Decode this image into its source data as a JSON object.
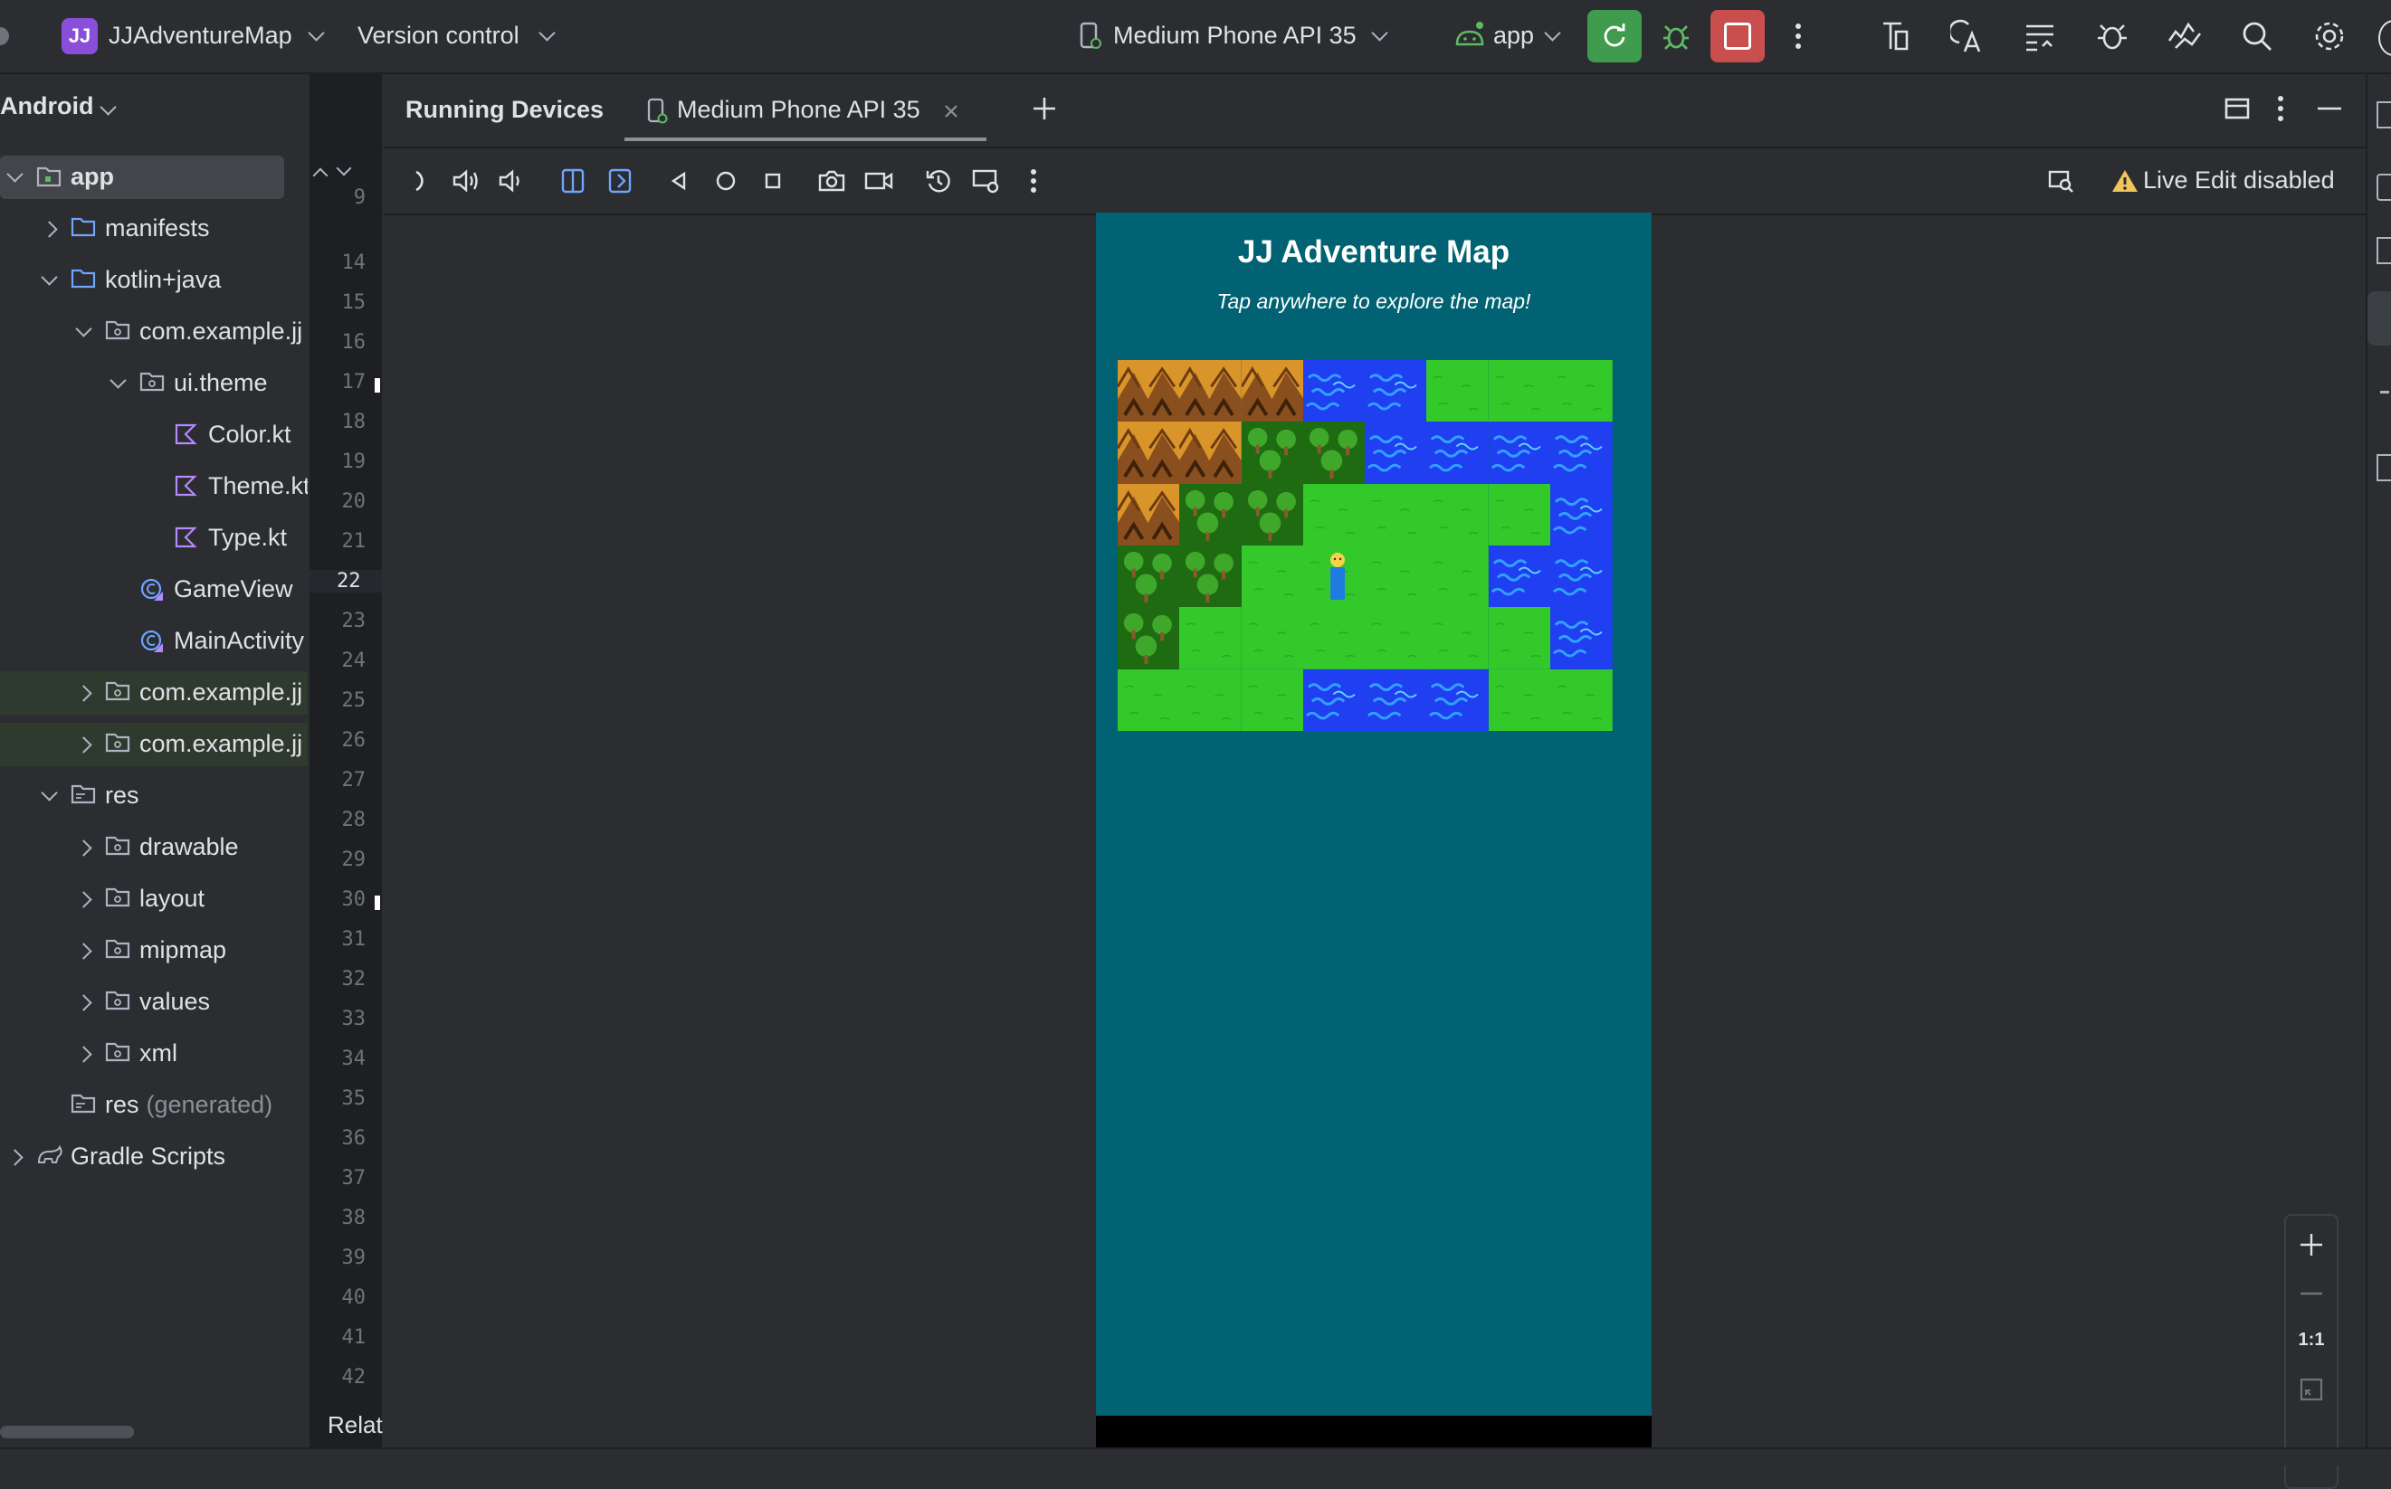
{
  "topbar": {
    "project_badge": "JJ",
    "project_name": "JJAdventureMap",
    "version_control": "Version control",
    "device_selector": "Medium Phone API 35",
    "run_config": "app"
  },
  "project_panel": {
    "view_mode": "Android",
    "tree": [
      {
        "label": "app",
        "depth": 0,
        "expanded": true,
        "icon": "module-icon",
        "selected": true
      },
      {
        "label": "manifests",
        "depth": 1,
        "expanded": false,
        "icon": "folder-icon"
      },
      {
        "label": "kotlin+java",
        "depth": 1,
        "expanded": true,
        "icon": "folder-icon"
      },
      {
        "label": "com.example.jj",
        "depth": 2,
        "expanded": true,
        "icon": "package-icon"
      },
      {
        "label": "ui.theme",
        "depth": 3,
        "expanded": true,
        "icon": "package-icon"
      },
      {
        "label": "Color.kt",
        "depth": 4,
        "icon": "kotlin-file-icon"
      },
      {
        "label": "Theme.kt",
        "depth": 4,
        "icon": "kotlin-file-icon"
      },
      {
        "label": "Type.kt",
        "depth": 4,
        "icon": "kotlin-file-icon"
      },
      {
        "label": "GameView",
        "depth": 3,
        "icon": "kotlin-class-icon"
      },
      {
        "label": "MainActivity",
        "depth": 3,
        "icon": "kotlin-class-icon"
      },
      {
        "label": "com.example.jj",
        "depth": 2,
        "expanded": false,
        "icon": "package-icon"
      },
      {
        "label": "com.example.jj",
        "depth": 2,
        "expanded": false,
        "icon": "package-icon"
      },
      {
        "label": "res",
        "depth": 1,
        "expanded": true,
        "icon": "res-folder-icon"
      },
      {
        "label": "drawable",
        "depth": 2,
        "expanded": false,
        "icon": "package-icon"
      },
      {
        "label": "layout",
        "depth": 2,
        "expanded": false,
        "icon": "package-icon"
      },
      {
        "label": "mipmap",
        "depth": 2,
        "expanded": false,
        "icon": "package-icon"
      },
      {
        "label": "values",
        "depth": 2,
        "expanded": false,
        "icon": "package-icon"
      },
      {
        "label": "xml",
        "depth": 2,
        "expanded": false,
        "icon": "package-icon"
      },
      {
        "label": "res",
        "suffix": "(generated)",
        "depth": 1,
        "icon": "res-folder-icon"
      },
      {
        "label": "Gradle Scripts",
        "depth": 0,
        "expanded": false,
        "icon": "gradle-icon"
      }
    ]
  },
  "gutter": {
    "lines": [
      "9",
      "14",
      "15",
      "16",
      "17",
      "18",
      "19",
      "20",
      "21",
      "22",
      "23",
      "24",
      "25",
      "26",
      "27",
      "28",
      "29",
      "30",
      "31",
      "32",
      "33",
      "34",
      "35",
      "36",
      "37",
      "38",
      "39",
      "40",
      "41",
      "42"
    ],
    "current_line": "22",
    "footer_text": "Relat"
  },
  "running_devices": {
    "panel_title": "Running Devices",
    "tab_label": "Medium Phone API 35",
    "live_edit": "Live Edit disabled",
    "zoom_actual": "1:1"
  },
  "app_screen": {
    "title": "JJ Adventure Map",
    "subtitle": "Tap anywhere to explore the map!",
    "map_grid": [
      [
        "M",
        "M",
        "M",
        "W",
        "W",
        "G",
        "G",
        "G"
      ],
      [
        "M",
        "M",
        "F",
        "F",
        "W",
        "W",
        "W",
        "W"
      ],
      [
        "M",
        "F",
        "F",
        "G",
        "G",
        "G",
        "G",
        "W"
      ],
      [
        "F",
        "F",
        "G",
        "G",
        "G",
        "G",
        "W",
        "W"
      ],
      [
        "F",
        "G",
        "G",
        "G",
        "G",
        "G",
        "G",
        "W"
      ],
      [
        "G",
        "G",
        "G",
        "W",
        "W",
        "W",
        "G",
        "G"
      ]
    ],
    "map_legend_codes": {
      "M": "mountain",
      "W": "water",
      "G": "grass",
      "F": "forest"
    },
    "player_position": {
      "col": 3,
      "row": 3
    }
  },
  "colors": {
    "ide_background": "#2b2d30",
    "editor_gutter": "#1e1f22",
    "phone_background": "#006272",
    "grass": "#34c92a",
    "water": "#1f3ff0",
    "mountain": "#d9952a",
    "forest": "#1e6b12",
    "run_button": "#3f9b4d",
    "stop_button": "#c94f4f",
    "project_badge": "#8a4fd8"
  }
}
